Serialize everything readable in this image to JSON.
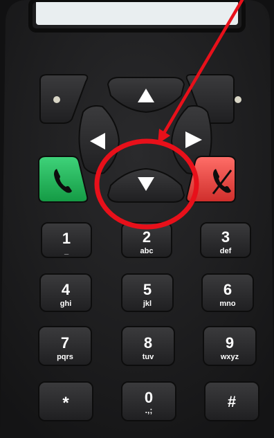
{
  "keypad": {
    "keys": [
      {
        "digit": "1",
        "letters": "_"
      },
      {
        "digit": "2",
        "letters": "abc"
      },
      {
        "digit": "3",
        "letters": "def"
      },
      {
        "digit": "4",
        "letters": "ghi"
      },
      {
        "digit": "5",
        "letters": "jkl"
      },
      {
        "digit": "6",
        "letters": "mno"
      },
      {
        "digit": "7",
        "letters": "pqrs"
      },
      {
        "digit": "8",
        "letters": "tuv"
      },
      {
        "digit": "9",
        "letters": "wxyz"
      },
      {
        "digit": "*",
        "letters": ""
      },
      {
        "digit": "0",
        "letters": ".,;"
      },
      {
        "digit": "#",
        "letters": ""
      }
    ]
  },
  "navigation": {
    "icons": [
      "arrow-up-icon",
      "arrow-left-icon",
      "arrow-right-icon",
      "arrow-down-icon"
    ]
  },
  "call_keys": {
    "answer_icon": "phone-answer-icon",
    "hangup_icon": "phone-hangup-icon",
    "answer_color": "#1fa84f",
    "hangup_color": "#e0453f"
  },
  "annotation": {
    "highlight_target": "arrow-down-icon",
    "color": "#e8101a"
  }
}
